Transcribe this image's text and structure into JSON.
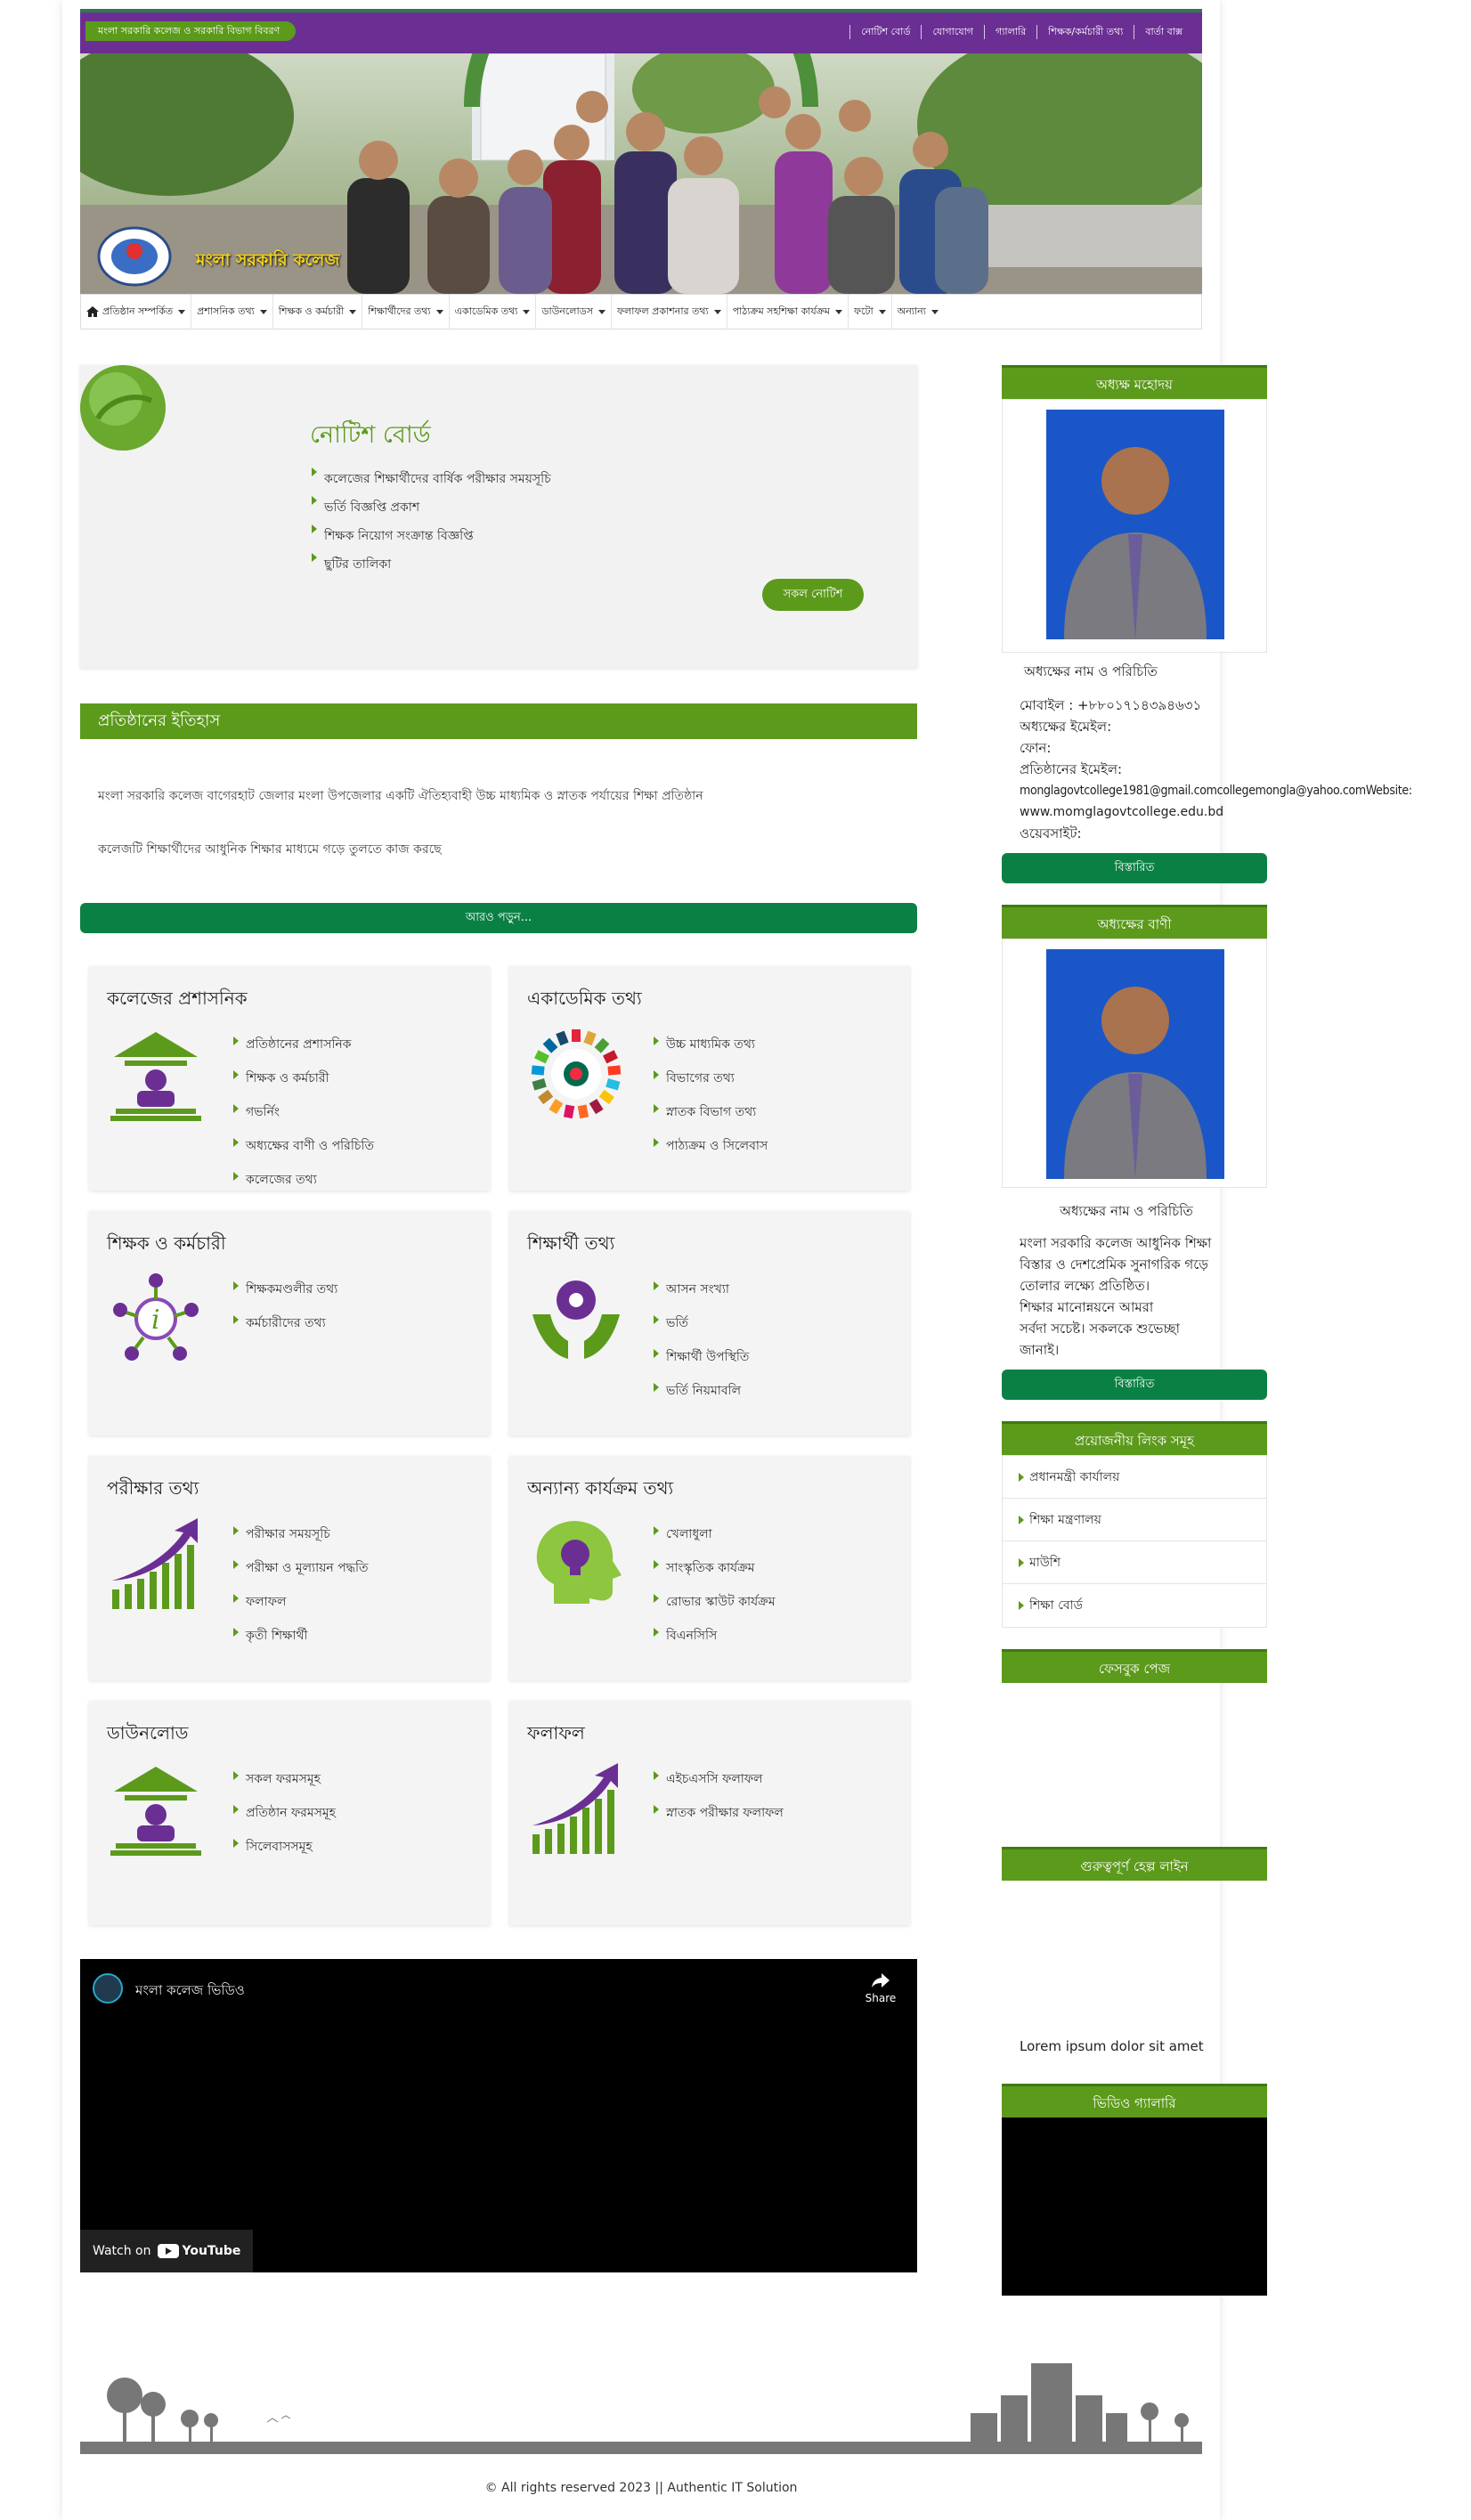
{
  "topbar": {
    "badge": "মংলা সরকারি কলেজ ও সরকারি বিভাগ বিবরণ",
    "links": [
      "নোটিশ বোর্ড",
      "যোগাযোগ",
      "গ্যালারি",
      "শিক্ষক/কর্মচারী তথ্য",
      "বার্তা বাক্স"
    ]
  },
  "banner": {
    "site_title": "মংলা সরকারি কলেজ"
  },
  "nav": {
    "home_icon": "home-icon",
    "items": [
      "প্রতিষ্ঠান সম্পর্কিত",
      "প্রশাসনিক তথ্য",
      "শিক্ষক ও কর্মচারী",
      "শিক্ষার্থীদের তথ্য",
      "একাডেমিক তথ্য",
      "ডাউনলোডস",
      "ফলাফল প্রকাশনার তথ্য",
      "পাঠ্যক্রম সহশিক্ষা কার্যক্রম",
      "ফটো",
      "অন্যান্য"
    ]
  },
  "notice": {
    "title": "নোটিশ বোর্ড",
    "items": [
      "কলেজের শিক্ষার্থীদের বার্ষিক পরীক্ষার সময়সূচি",
      "ভর্তি বিজ্ঞপ্তি প্রকাশ",
      "শিক্ষক নিয়োগ সংক্রান্ত বিজ্ঞপ্তি",
      "ছুটির তালিকা"
    ],
    "all_button": "সকল নোটিশ"
  },
  "about": {
    "title": "প্রতিষ্ঠানের ইতিহাস",
    "line1": "মংলা সরকারি কলেজ বাগেরহাট জেলার মংলা উপজেলার একটি ঐতিহ্যবাহী উচ্চ মাধ্যমিক ও স্নাতক পর্যায়ের শিক্ষা প্রতিষ্ঠান",
    "line2": "কলেজটি শিক্ষার্থীদের আধুনিক শিক্ষার মাধ্যমে গড়ে তুলতে কাজ করছে",
    "more_button": "আরও পড়ুন..."
  },
  "services": [
    {
      "title": "কলেজের প্রশাসনিক",
      "icon": "institution-icon",
      "items": [
        "প্রতিষ্ঠানের প্রশাসনিক",
        "শিক্ষক ও কর্মচারী",
        "গভর্নিং",
        "অধ্যক্ষের বাণী ও পরিচিতি",
        "কলেজের তথ্য"
      ]
    },
    {
      "title": "একাডেমিক তথ্য",
      "icon": "sdg-wheel-icon",
      "items": [
        "উচ্চ মাধ্যমিক তথ্য",
        "বিভাগের তথ্য",
        "স্নাতক বিভাগ তথ্য",
        "পাঠ্যক্রম ও সিলেবাস"
      ]
    },
    {
      "title": "শিক্ষক ও কর্মচারী",
      "icon": "info-network-icon",
      "items": [
        "শিক্ষকমণ্ডলীর তথ্য",
        "কর্মচারীদের তথ্য"
      ]
    },
    {
      "title": "শিক্ষার্থী তথ্য",
      "icon": "gear-hands-icon",
      "items": [
        "আসন সংখ্যা",
        "ভর্তি",
        "শিক্ষার্থী উপস্থিতি",
        "ভর্তি নিয়মাবলি"
      ]
    },
    {
      "title": "পরীক্ষার তথ্য",
      "icon": "growth-chart-icon",
      "items": [
        "পরীক্ষার সময়সূচি",
        "পরীক্ষা ও মূল্যায়ন পদ্ধতি",
        "ফলাফল",
        "কৃতী শিক্ষার্থী"
      ]
    },
    {
      "title": "অন্যান্য কার্যক্রম তথ্য",
      "icon": "idea-head-icon",
      "items": [
        "খেলাধুলা",
        "সাংস্কৃতিক কার্যক্রম",
        "রোভার স্কাউট কার্যক্রম",
        "বিএনসিসি"
      ]
    },
    {
      "title": "ডাউনলোড",
      "icon": "institution-icon-2",
      "items": [
        "সকল ফরমসমূহ",
        "প্রতিষ্ঠান ফরমসমূহ",
        "সিলেবাসসমূহ"
      ]
    },
    {
      "title": "ফলাফল",
      "icon": "growth-chart-icon-2",
      "items": [
        "এইচএসসি ফলাফল",
        "স্নাতক পরীক্ষার ফলাফল"
      ]
    }
  ],
  "video": {
    "title": "মংলা কলেজ ভিডিও",
    "share": "Share",
    "watch_on": "Watch on",
    "youtube": "YouTube"
  },
  "sidebar": {
    "principal": {
      "header": "অধ্যক্ষ মহোদয়",
      "name": "অধ্যক্ষের নাম ও পরিচিতি",
      "phone_label": "মোবাইল : +৮৮০১৭১৪৩৯৪৬৩১",
      "email_label": "অধ্যক্ষের ইমেইল:",
      "website_label": "ওয়েবসাইট:",
      "emails_label": "প্রতিষ্ঠানের ইমেইল:",
      "emails": "monglagovtcollege1981@gmail.comcollegemongla@yahoo.comWebsite:",
      "website": "www.momglagovtcollege.edu.bd",
      "extra": "ফোন:",
      "button": "বিস্তারিত"
    },
    "message": {
      "header": "অধ্যক্ষের বাণী",
      "name": "অধ্যক্ষের নাম ও পরিচিতি",
      "text": [
        "মংলা সরকারি কলেজ আধুনিক শিক্ষা",
        "বিস্তার ও দেশপ্রেমিক সুনাগরিক গড়ে",
        "তোলার লক্ষ্যে প্রতিষ্ঠিত।",
        "শিক্ষার মানোন্নয়নে আমরা",
        "সর্বদা সচেষ্ট। সকলকে শুভেচ্ছা",
        "জানাই।"
      ],
      "button": "বিস্তারিত"
    },
    "links": {
      "header": "প্রয়োজনীয় লিংক সমূহ",
      "items": [
        "প্রধানমন্ত্রী কার্যালয়",
        "শিক্ষা মন্ত্রণালয়",
        "মাউশি",
        "শিক্ষা বোর্ড"
      ]
    },
    "facebook": {
      "header": "ফেসবুক পেজ"
    },
    "helpline": {
      "header": "গুরুত্বপূর্ণ হেল্প লাইন",
      "text": "Lorem ipsum dolor sit amet"
    },
    "video": {
      "header": "ভিডিও গ্যালারি"
    }
  },
  "footer": {
    "copyright": "© All rights reserved 2023 || ",
    "company": "Authentic IT Solution"
  },
  "colors": {
    "purple": "#6b2f94",
    "green": "#5c9a1b",
    "dark_green": "#0b8045"
  }
}
